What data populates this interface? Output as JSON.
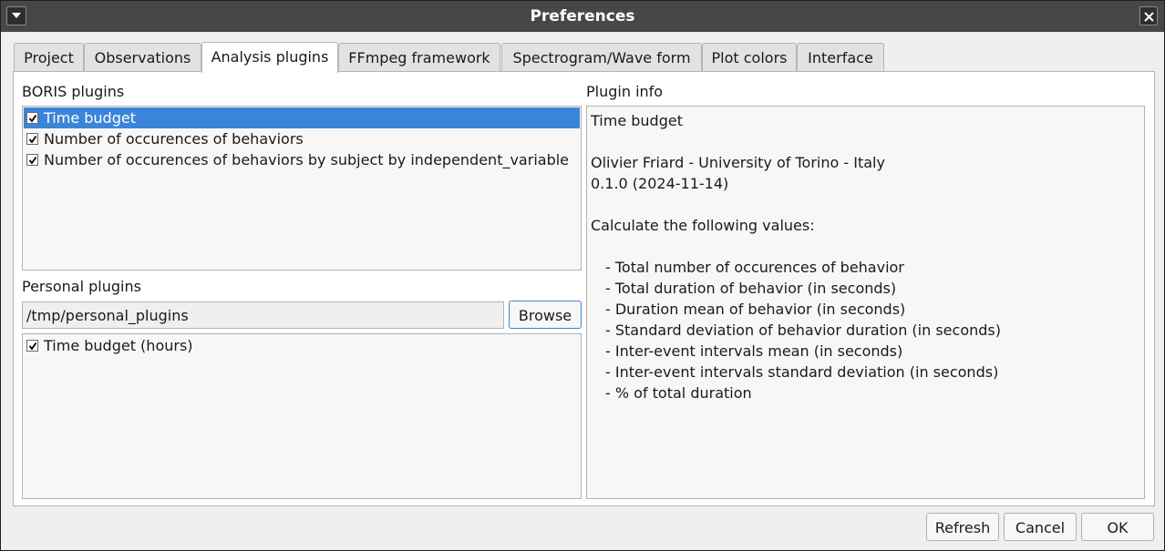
{
  "window": {
    "title": "Preferences"
  },
  "tabs": [
    {
      "label": "Project"
    },
    {
      "label": "Observations"
    },
    {
      "label": "Analysis plugins"
    },
    {
      "label": "FFmpeg framework"
    },
    {
      "label": "Spectrogram/Wave form"
    },
    {
      "label": "Plot colors"
    },
    {
      "label": "Interface"
    }
  ],
  "boris_plugins": {
    "label": "BORIS plugins",
    "items": [
      {
        "label": "Time budget",
        "checked": true,
        "selected": true
      },
      {
        "label": "Number of occurences of behaviors",
        "checked": true,
        "selected": false
      },
      {
        "label": "Number of occurences of behaviors by subject by independent_variable",
        "checked": true,
        "selected": false
      }
    ]
  },
  "personal_plugins": {
    "label": "Personal plugins",
    "path": "/tmp/personal_plugins",
    "browse_label": "Browse",
    "items": [
      {
        "label": "Time budget (hours)",
        "checked": true
      }
    ]
  },
  "plugin_info": {
    "label": "Plugin info",
    "name": "Time budget",
    "author": "Olivier Friard - University of Torino - Italy",
    "version": "0.1.0 (2024-11-14)",
    "description": "Calculate the following values:",
    "values": [
      "- Total number of occurences of behavior",
      "- Total duration of behavior (in seconds)",
      "- Duration mean of behavior (in seconds)",
      "- Standard deviation of behavior duration (in seconds)",
      "- Inter-event intervals mean (in seconds)",
      "- Inter-event intervals standard deviation (in seconds)",
      "- % of total duration"
    ]
  },
  "buttons": {
    "refresh": "Refresh",
    "cancel": "Cancel",
    "ok": "OK"
  },
  "colors": {
    "titlebar": "#474747",
    "selection": "#3b85d8"
  }
}
